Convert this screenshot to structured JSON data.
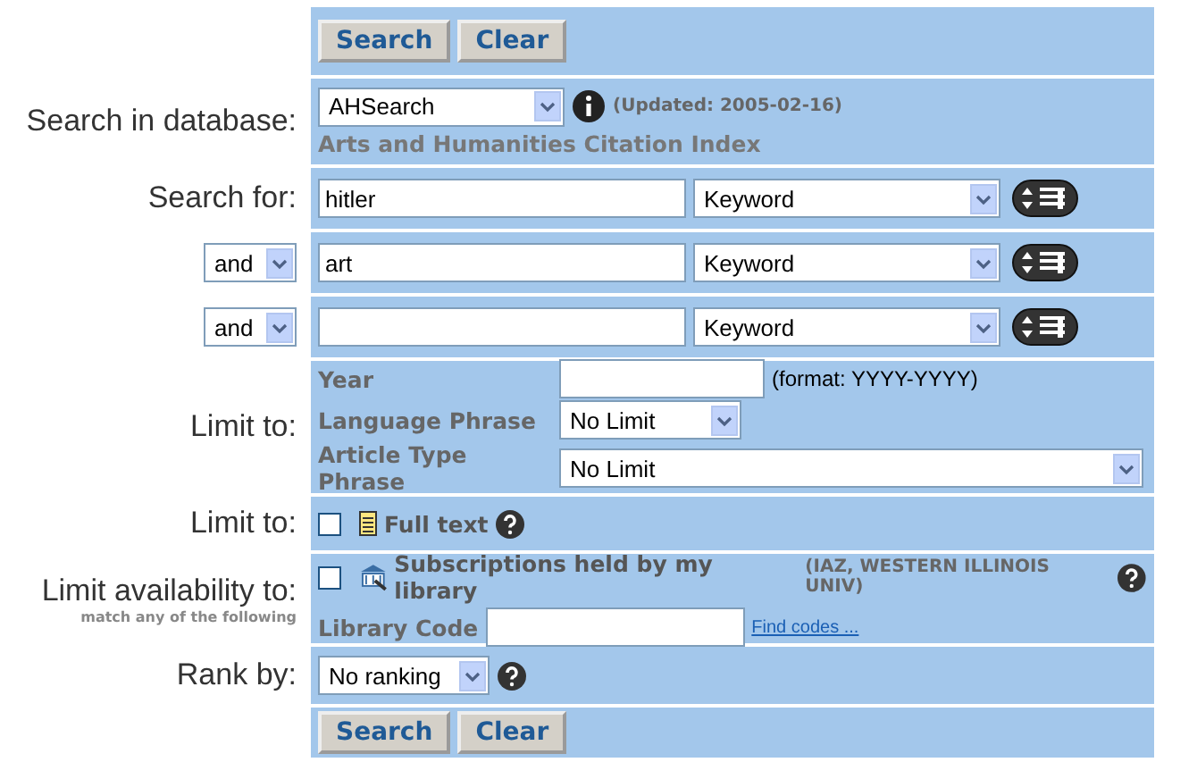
{
  "top_buttons": [
    "Search",
    "Clear"
  ],
  "database": {
    "label": "Search in database:",
    "value": "AHSearch",
    "updated": "(Updated: 2005-02-16)",
    "name": "Arts and Humanities Citation Index"
  },
  "search_rows": [
    {
      "kind": "label",
      "label": "Search for:",
      "value": "hitler",
      "field": "Keyword"
    },
    {
      "kind": "operator",
      "operator": "and",
      "value": "art",
      "field": "Keyword"
    },
    {
      "kind": "operator",
      "operator": "and",
      "field": "Keyword"
    }
  ],
  "limits": {
    "label": "Limit to:",
    "year_label": "Year",
    "year_hint": "(format: YYYY-YYYY)",
    "language_label": "Language Phrase",
    "language": "No Limit",
    "article_label": "Article Type Phrase",
    "article": "No Limit"
  },
  "full_text": {
    "label": "Limit to:",
    "text": "Full text",
    "checked": false
  },
  "availability": {
    "label": "Limit availability to:",
    "sublabel": "match any of the following",
    "text": "Subscriptions held by my library",
    "library": "(IAZ, WESTERN ILLINOIS UNIV)",
    "checked": false,
    "code_label": "Library Code",
    "link": "Find codes ..."
  },
  "rank": {
    "label": "Rank by:",
    "value": "No ranking"
  },
  "bottom_buttons": [
    "Search",
    "Clear"
  ]
}
